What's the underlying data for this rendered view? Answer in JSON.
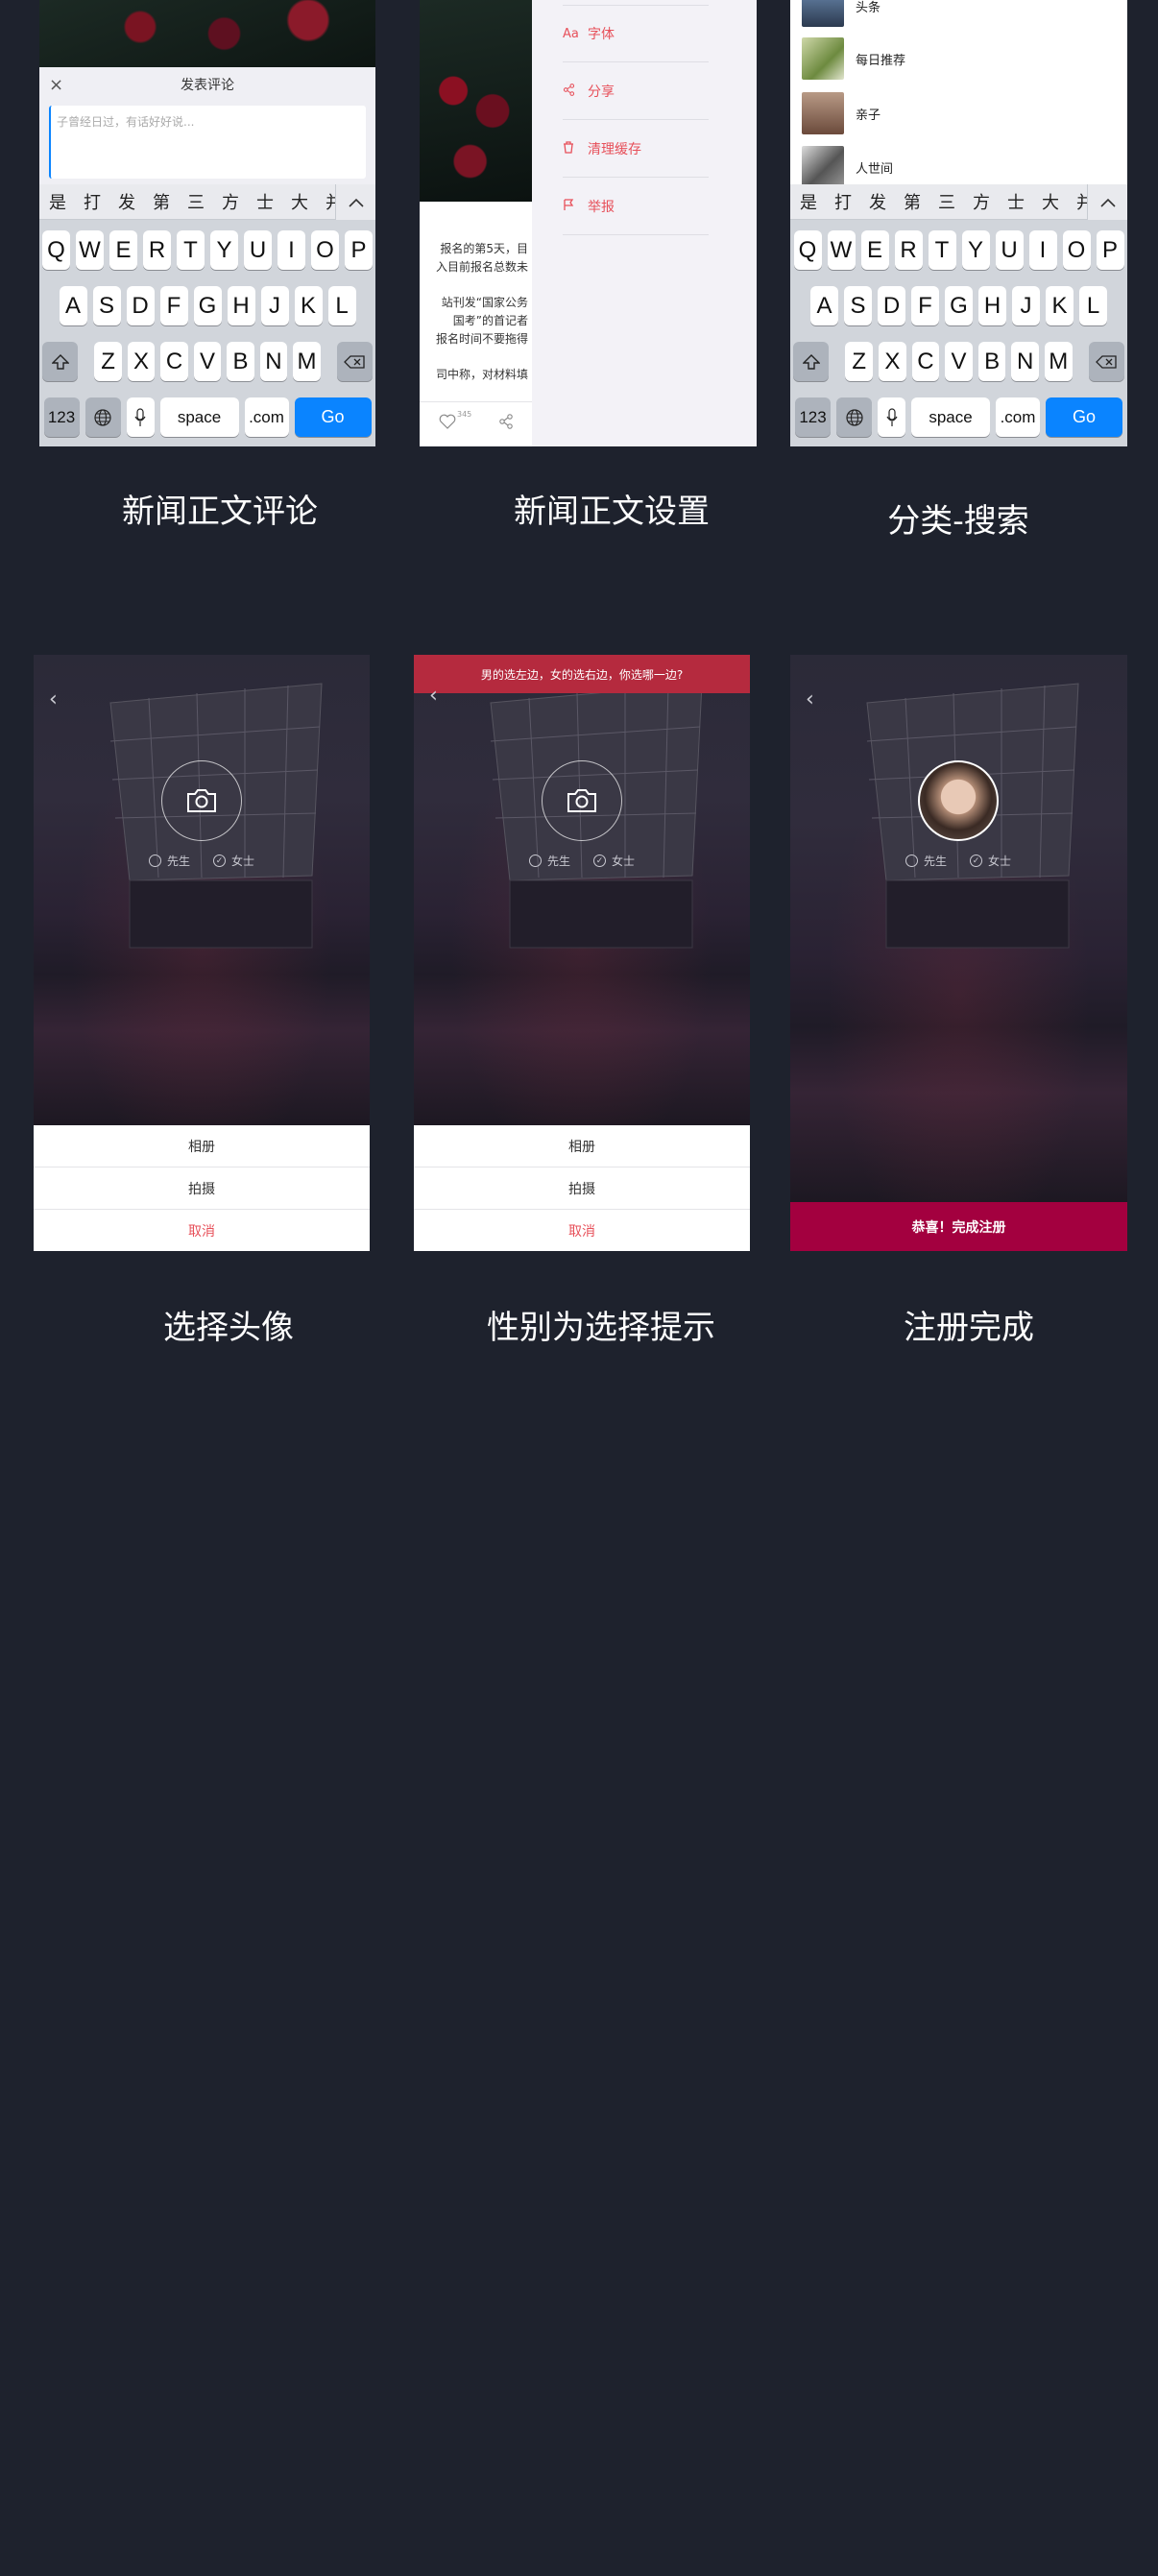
{
  "captions": {
    "c1": "新闻正文评论",
    "c2": "新闻正文设置",
    "c3": "分类-搜索",
    "c4": "选择头像",
    "c5": "性别为选择提示",
    "c6": "注册完成"
  },
  "comment": {
    "title": "发表评论",
    "close": "×",
    "placeholder": "子曾经日过，有话好好说..."
  },
  "keyboard": {
    "suggestions": [
      "是",
      "打",
      "发",
      "第",
      "三",
      "方",
      "士",
      "大",
      "并"
    ],
    "row1": [
      "Q",
      "W",
      "E",
      "R",
      "T",
      "Y",
      "U",
      "I",
      "O",
      "P"
    ],
    "row2": [
      "A",
      "S",
      "D",
      "F",
      "G",
      "H",
      "J",
      "K",
      "L"
    ],
    "row3": [
      "Z",
      "X",
      "C",
      "V",
      "B",
      "N",
      "M"
    ],
    "num": "123",
    "space": "space",
    "dotcom": ".com",
    "go": "Go"
  },
  "article": {
    "lines": [
      "报名的第5天，目",
      "入目前报名总数未",
      "站刊发“国家公务",
      "国考”的首记者",
      "报名时间不要拖得",
      "司中称，对材料填"
    ],
    "like_count": "345"
  },
  "settings": {
    "items": [
      {
        "icon": "Aa",
        "label": "字体"
      },
      {
        "icon": "share",
        "label": "分享"
      },
      {
        "icon": "trash",
        "label": "清理缓存"
      },
      {
        "icon": "flag",
        "label": "举报"
      }
    ]
  },
  "categories": {
    "items": [
      "头条",
      "每日推荐",
      "亲子",
      "人世间"
    ]
  },
  "register": {
    "back": "‹",
    "male": "先生",
    "female": "女士",
    "sheet_album": "相册",
    "sheet_shoot": "拍摄",
    "sheet_cancel": "取消",
    "gender_tip": "男的选左边，女的选右边，你选哪一边?",
    "done": "恭喜！完成注册"
  },
  "colors": {
    "background": "#1e222d",
    "accent_red": "#e7505a",
    "tip_banner": "#b52a3e",
    "done_bar": "#a3003f",
    "go_key": "#0a84ff"
  }
}
